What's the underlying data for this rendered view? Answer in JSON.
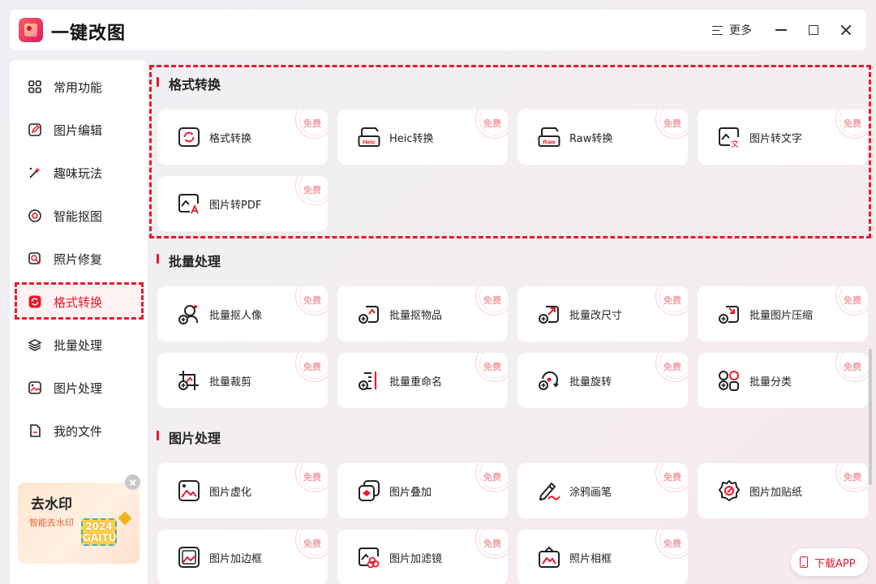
{
  "app": {
    "title": "一键改图"
  },
  "titlebar": {
    "more_label": "更多"
  },
  "sidebar": {
    "items": [
      {
        "label": "常用功能",
        "icon": "grid-icon"
      },
      {
        "label": "图片编辑",
        "icon": "edit-icon"
      },
      {
        "label": "趣味玩法",
        "icon": "magic-wand-icon"
      },
      {
        "label": "智能抠图",
        "icon": "target-icon"
      },
      {
        "label": "照片修复",
        "icon": "photo-repair-icon"
      },
      {
        "label": "格式转换",
        "icon": "convert-icon",
        "active": true
      },
      {
        "label": "批量处理",
        "icon": "layers-icon"
      },
      {
        "label": "图片处理",
        "icon": "image-icon"
      },
      {
        "label": "我的文件",
        "icon": "file-icon"
      }
    ],
    "promo": {
      "title": "去水印",
      "subtitle": "智能去水印",
      "badge_line1": "2024",
      "badge_line2": "GAITU"
    }
  },
  "sections": [
    {
      "title": "格式转换",
      "cards": [
        {
          "label": "格式转换",
          "icon": "format-convert-icon",
          "badge": "免费"
        },
        {
          "label": "Heic转换",
          "icon": "heic-icon",
          "badge": "免费"
        },
        {
          "label": "Raw转换",
          "icon": "raw-icon",
          "badge": "免费"
        },
        {
          "label": "图片转文字",
          "icon": "image-to-text-icon",
          "badge": "免费"
        },
        {
          "label": "图片转PDF",
          "icon": "image-to-pdf-icon",
          "badge": "免费"
        }
      ]
    },
    {
      "title": "批量处理",
      "cards": [
        {
          "label": "批量抠人像",
          "icon": "batch-portrait-icon",
          "badge": "免费"
        },
        {
          "label": "批量抠物品",
          "icon": "batch-object-icon",
          "badge": "免费"
        },
        {
          "label": "批量改尺寸",
          "icon": "batch-resize-icon",
          "badge": "免费"
        },
        {
          "label": "批量图片压缩",
          "icon": "batch-compress-icon",
          "badge": "免费"
        },
        {
          "label": "批量裁剪",
          "icon": "batch-crop-icon",
          "badge": "免费"
        },
        {
          "label": "批量重命名",
          "icon": "batch-rename-icon",
          "badge": "免费"
        },
        {
          "label": "批量旋转",
          "icon": "batch-rotate-icon",
          "badge": "免费"
        },
        {
          "label": "批量分类",
          "icon": "batch-classify-icon",
          "badge": "免费"
        }
      ]
    },
    {
      "title": "图片处理",
      "cards": [
        {
          "label": "图片虚化",
          "icon": "blur-icon",
          "badge": "免费"
        },
        {
          "label": "图片叠加",
          "icon": "overlay-icon",
          "badge": "免费"
        },
        {
          "label": "涂鸦画笔",
          "icon": "brush-icon",
          "badge": "免费"
        },
        {
          "label": "图片加贴纸",
          "icon": "sticker-icon",
          "badge": "免费"
        },
        {
          "label": "图片加边框",
          "icon": "border-icon",
          "badge": "免费"
        },
        {
          "label": "图片加滤镜",
          "icon": "filter-icon",
          "badge": "免费"
        },
        {
          "label": "照片相框",
          "icon": "photo-frame-icon",
          "badge": "免费"
        }
      ]
    }
  ],
  "download": {
    "label": "下载APP"
  },
  "colors": {
    "accent": "#e8192c",
    "badge": "#f1a2aa"
  }
}
